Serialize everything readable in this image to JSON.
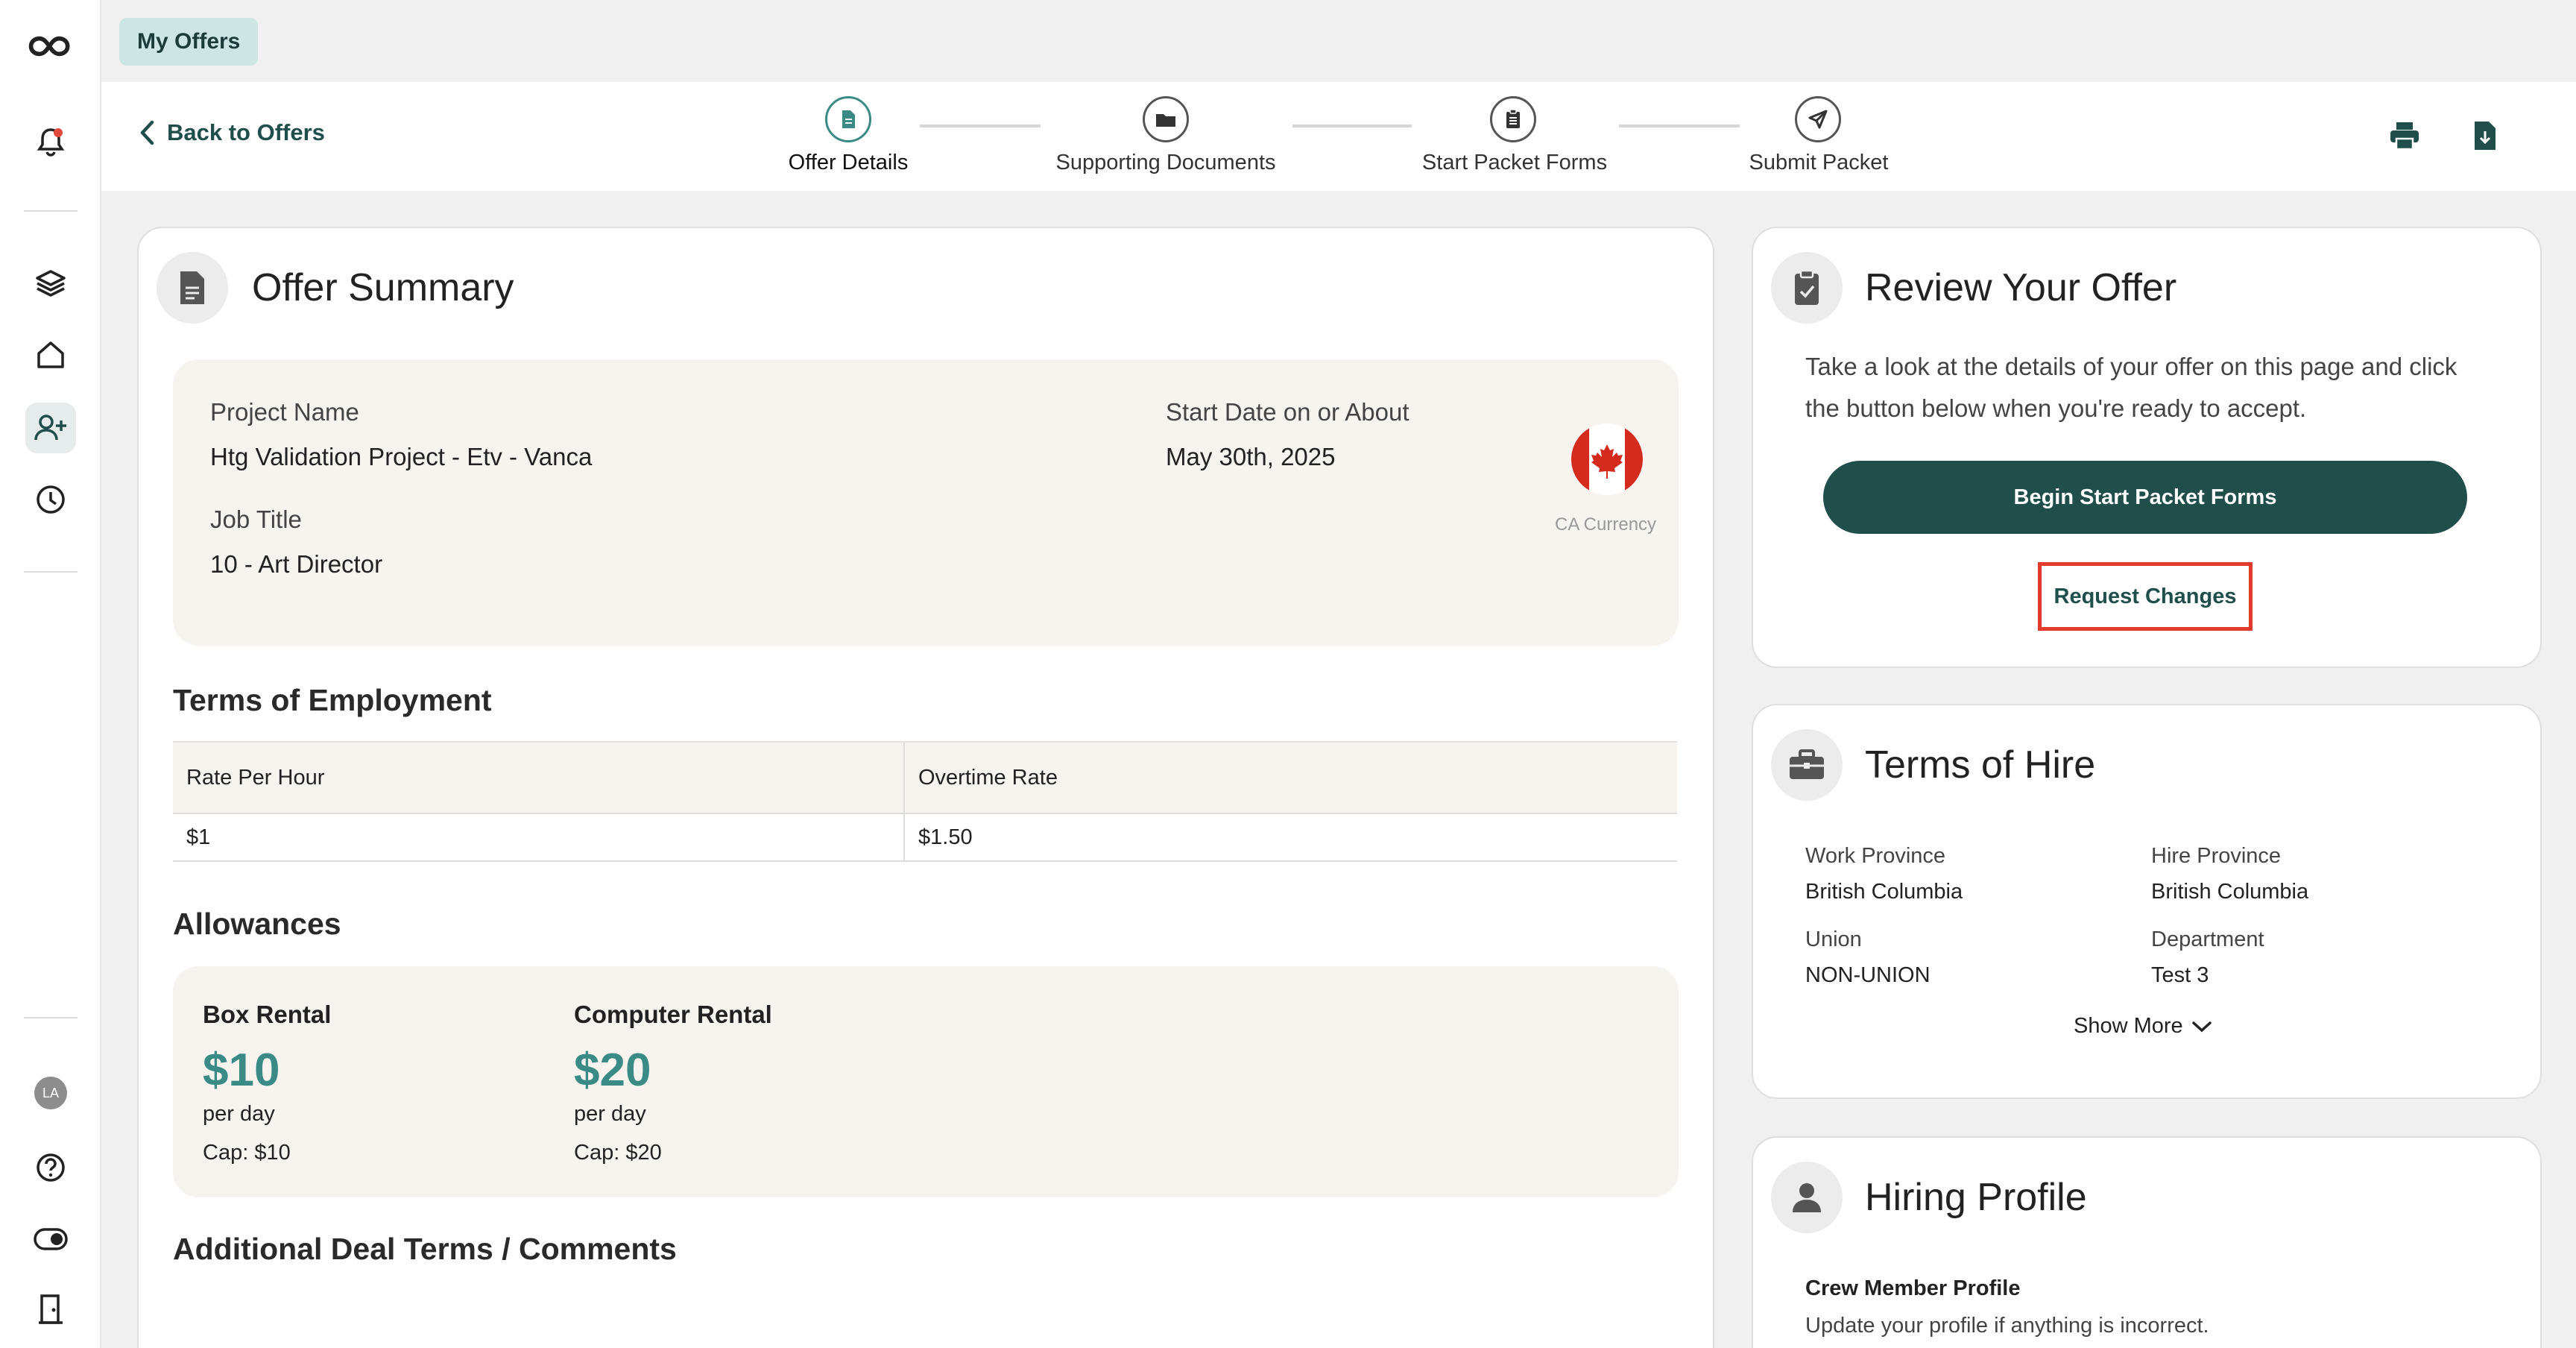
{
  "nav": {
    "tab_label": "My Offers",
    "back_label": "Back to Offers",
    "avatar_initials": "LA"
  },
  "steps": [
    {
      "label": "Offer Details",
      "icon": "document-icon",
      "active": true
    },
    {
      "label": "Supporting Documents",
      "icon": "folder-icon",
      "active": false
    },
    {
      "label": "Start Packet Forms",
      "icon": "clipboard-icon",
      "active": false
    },
    {
      "label": "Submit Packet",
      "icon": "send-icon",
      "active": false
    }
  ],
  "offer_summary": {
    "title": "Offer Summary",
    "project_name_label": "Project Name",
    "project_name_value": "Htg Validation Project - Etv - Vanca",
    "start_date_label": "Start Date on or About",
    "start_date_value": "May 30th, 2025",
    "job_title_label": "Job Title",
    "job_title_value": "10 - Art Director",
    "currency_label": "CA Currency"
  },
  "terms_of_employment": {
    "title": "Terms of Employment",
    "headers": [
      "Rate Per Hour",
      "Overtime Rate"
    ],
    "values": [
      "$1",
      "$1.50"
    ]
  },
  "allowances": {
    "title": "Allowances",
    "items": [
      {
        "name": "Box Rental",
        "amount": "$10",
        "period": "per day",
        "cap": "Cap: $10"
      },
      {
        "name": "Computer Rental",
        "amount": "$20",
        "period": "per day",
        "cap": "Cap: $20"
      }
    ]
  },
  "additional_terms": {
    "title": "Additional Deal Terms / Comments"
  },
  "review": {
    "title": "Review Your Offer",
    "text": "Take a look at the details of your offer on this page and click the button below when you're ready to accept.",
    "primary_button": "Begin Start Packet Forms",
    "secondary_button": "Request Changes"
  },
  "terms_of_hire": {
    "title": "Terms of Hire",
    "work_province_label": "Work Province",
    "work_province_value": "British Columbia",
    "hire_province_label": "Hire Province",
    "hire_province_value": "British Columbia",
    "union_label": "Union",
    "union_value": "NON-UNION",
    "department_label": "Department",
    "department_value": "Test 3",
    "show_more": "Show More"
  },
  "hiring_profile": {
    "title": "Hiring Profile",
    "subtitle": "Crew Member Profile",
    "text": "Update your profile if anything is incorrect."
  },
  "colors": {
    "primary": "#1f4e4b",
    "accent": "#3a8a86",
    "highlight": "#e23b2e"
  }
}
